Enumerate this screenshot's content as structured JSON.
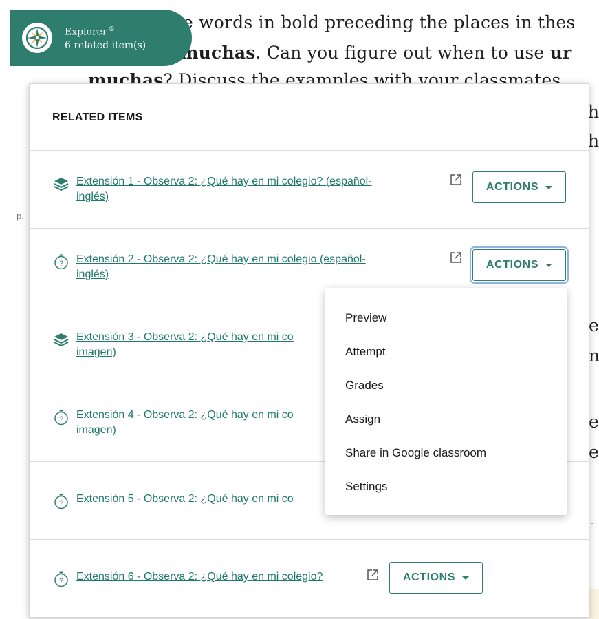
{
  "background": {
    "line1": "e words in bold preceding the places in thes",
    "line2_bold": "muchas",
    "line2_rest": ". Can you figure out when to use ",
    "line2_bold2": "ur",
    "line3_bold": "muchas",
    "line3_rest": "? Discuss the examples with your classmates",
    "frag_h1": "h",
    "frag_h2": "h",
    "frag_e1": "e",
    "frag_n1": "n",
    "frag_e2": "e",
    "frag_e3": "e",
    "page_marker": "p."
  },
  "explorer": {
    "title": "Explorer",
    "registered": "®",
    "subtitle": "6 related item(s)"
  },
  "panel": {
    "title": "RELATED ITEMS"
  },
  "items": [
    {
      "icon": "layers-icon",
      "line1": "Extensión 1 - Observa 2: ¿Qué hay en mi colegio? (español-",
      "line2": "inglés)",
      "actions_label": "ACTIONS"
    },
    {
      "icon": "stopwatch-question-icon",
      "line1": "Extensión 2 - Observa 2: ¿Qué hay en mi colegio (español-",
      "line2": "inglés)",
      "actions_label": "ACTIONS"
    },
    {
      "icon": "layers-icon",
      "line1": "Extensión 3 - Observa 2: ¿Qué hay en mi co",
      "line2": "imagen)"
    },
    {
      "icon": "stopwatch-question-icon",
      "line1": "Extensión 4 - Observa 2: ¿Qué hay en mi co",
      "line2": "imagen)"
    },
    {
      "icon": "stopwatch-question-icon",
      "line1": "Extensión 5 - Observa 2: ¿Qué hay en mi co"
    },
    {
      "icon": "stopwatch-question-icon",
      "line1": "Extensión 6 - Observa 2: ¿Qué hay en mi colegio?",
      "actions_label": "ACTIONS"
    }
  ],
  "dropdown": {
    "items": [
      "Preview",
      "Attempt",
      "Grades",
      "Assign",
      "Share in Google classroom",
      "Settings"
    ]
  },
  "colors": {
    "brand": "#2e7d6f",
    "link": "#1f7a6c",
    "focus_ring": "#8fb3e3"
  }
}
